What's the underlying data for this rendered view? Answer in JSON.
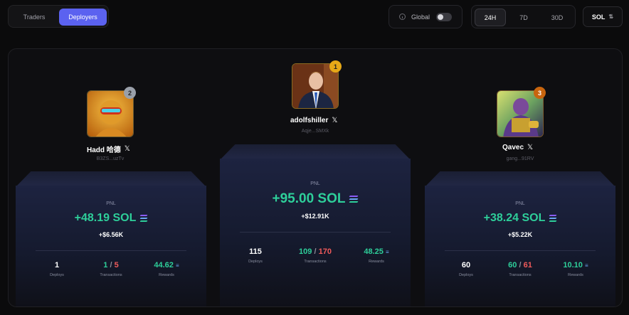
{
  "tabs": {
    "traders": "Traders",
    "deployers": "Deployers"
  },
  "global": {
    "label": "Global"
  },
  "periods": {
    "p24h": "24H",
    "p7d": "7D",
    "p30d": "30D"
  },
  "currency": {
    "label": "SOL",
    "sort_icon": "⇅"
  },
  "leaders": {
    "first": {
      "rank": "1",
      "name": "adolfshiller",
      "address": "Aqje...SMXk",
      "pnl_label": "PNL",
      "pnl_sol": "+95.00 SOL",
      "pnl_usd": "+$12.91K",
      "deploys": "115",
      "deploys_label": "Deploys",
      "tx_success": "109",
      "tx_separator": "/",
      "tx_total": "170",
      "tx_label": "Transactions",
      "rewards": "48.25",
      "rewards_label": "Rewards"
    },
    "second": {
      "rank": "2",
      "name": "Hadd 哈德",
      "address": "B3ZS...uzTv",
      "pnl_label": "PNL",
      "pnl_sol": "+48.19 SOL",
      "pnl_usd": "+$6.56K",
      "deploys": "1",
      "deploys_label": "Deploys",
      "tx_success": "1",
      "tx_separator": "/",
      "tx_total": "5",
      "tx_label": "Transactions",
      "rewards": "44.62",
      "rewards_label": "Rewards"
    },
    "third": {
      "rank": "3",
      "name": "Qavec",
      "address": "gang...91RV",
      "pnl_label": "PNL",
      "pnl_sol": "+38.24 SOL",
      "pnl_usd": "+$5.22K",
      "deploys": "60",
      "deploys_label": "Deploys",
      "tx_success": "60",
      "tx_separator": "/",
      "tx_total": "61",
      "tx_label": "Transactions",
      "rewards": "10.10",
      "rewards_label": "Rewards"
    }
  },
  "icons": {
    "x": "𝕏",
    "info": "info-icon",
    "solana": "solana-icon"
  },
  "colors": {
    "accent": "#5b62f0",
    "positive": "#2ecf9a",
    "negative": "#f05a5a",
    "gold": "#e6a817",
    "silver": "#9aa0aa",
    "bronze": "#c8650e"
  }
}
